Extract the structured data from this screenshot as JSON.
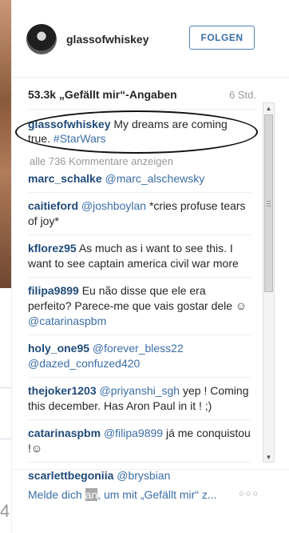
{
  "post": {
    "username": "glassofwhiskey",
    "follow_label": "FOLGEN",
    "likes": "53.3k „Gefällt mir“-Angaben",
    "time": "6 Std.",
    "caption": {
      "username": "glassofwhiskey",
      "text": "My dreams are coming true.",
      "hashtag": "#StarWars"
    },
    "more_comments": "alle 736 Kommentare anzeigen"
  },
  "comments": [
    {
      "user": "marc_schalke",
      "mention": "@marc_alschewsky",
      "text": ""
    },
    {
      "user": "caitieford",
      "mention": "@joshboylan",
      "text": "*cries profuse tears of joy*"
    },
    {
      "user": "kflorez95",
      "mention": "",
      "text": "As much as i want to see this. I want to see captain america civil war more"
    },
    {
      "user": "filipa9899",
      "mention": "",
      "text": "Eu não disse que ele era perfeito? Parece-me que vais gostar dele ☺"
    },
    {
      "user": "",
      "mention": "@catarinaspbm",
      "text": ""
    },
    {
      "user": "holy_one95",
      "mention": "@forever_bless22",
      "text": ""
    },
    {
      "user": "",
      "mention": "@dazed_confuzed420",
      "text": ""
    },
    {
      "user": "thejoker1203",
      "mention": "@priyanshi_sgh",
      "text": "yep ! Coming this december. Has Aron Paul in it ! ;)"
    },
    {
      "user": "catarinaspbm",
      "mention": "@filipa9899",
      "text": "já me conquistou !☺"
    },
    {
      "user": "scarlettbegoniia",
      "mention": "@brysbian",
      "text": ""
    }
  ],
  "footer": {
    "login_pre": "Melde dich ",
    "login_highlight": "an",
    "login_post": ", um mit „Gefällt mir“ z...",
    "more_label": "○○○"
  },
  "scrollbar": {
    "up": "▲",
    "down": "▼"
  },
  "background": {
    "digit": "4"
  }
}
